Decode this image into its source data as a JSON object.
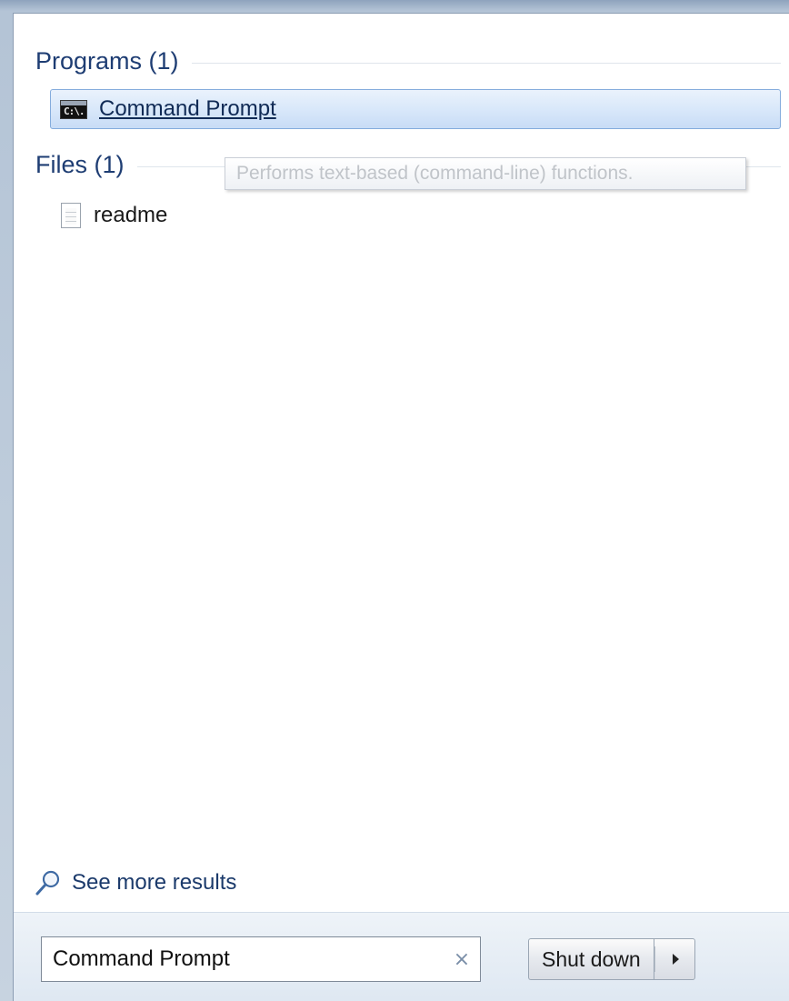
{
  "programs": {
    "header": "Programs (1)",
    "items": [
      {
        "label": "Command Prompt",
        "icon": "cmd-console-icon",
        "icon_text": "C:\\."
      }
    ]
  },
  "files": {
    "header": "Files (1)",
    "items": [
      {
        "label": "readme",
        "icon": "text-file-icon"
      }
    ]
  },
  "tooltip": {
    "text": "Performs text-based (command-line) functions."
  },
  "see_more": {
    "label": "See more results",
    "icon": "magnifier-icon"
  },
  "search": {
    "value": "Command Prompt",
    "clear_icon": "close-icon",
    "clear_glyph": "×"
  },
  "power": {
    "shutdown_label": "Shut down",
    "arrow_icon": "chevron-right-icon"
  },
  "colors": {
    "highlight_border": "#84acdd",
    "highlight_fill": "#d9e8fa",
    "header_text": "#1e3d73",
    "bottom_bar": "#dce6f1"
  }
}
